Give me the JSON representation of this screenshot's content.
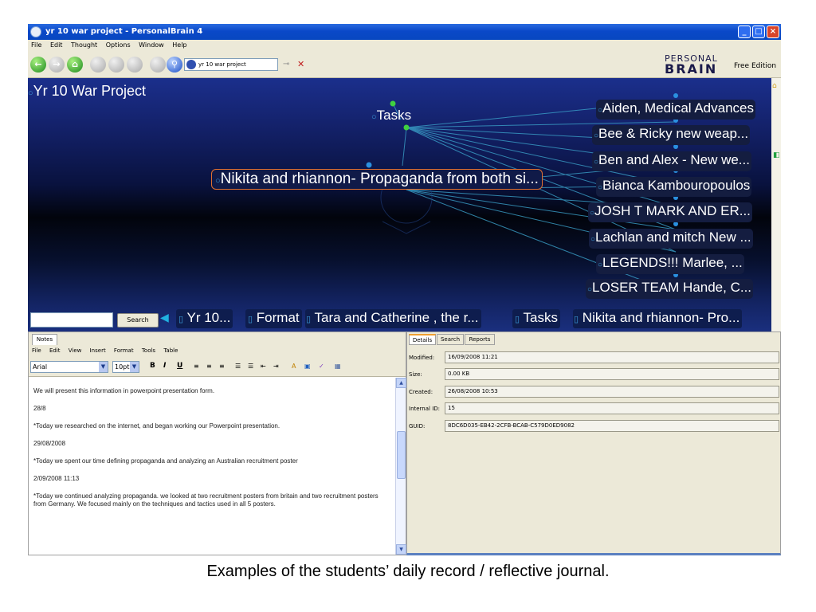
{
  "window": {
    "title": "yr 10 war project - PersonalBrain 4",
    "menu": [
      "File",
      "Edit",
      "Thought",
      "Options",
      "Window",
      "Help"
    ]
  },
  "toolbar": {
    "brain_selector": "yr 10 war project",
    "logo_line1": "PERSONAL",
    "logo_line2": "BRAIN",
    "edition": "Free Edition"
  },
  "plex": {
    "active_thought": "Yr 10 War Project",
    "parent_thought": "Tasks",
    "central_thought": "Nikita and rhiannon- Propaganda from both si...",
    "children": [
      "Aiden, Medical Advances",
      "Bee & Ricky new weap...",
      "Ben and Alex - New we...",
      "Bianca Kambouropoulos",
      "JOSH T MARK AND ER...",
      "Lachlan and mitch New ...",
      "LEGENDS!!!  Marlee, ...",
      "LOSER TEAM Hande, C..."
    ],
    "search_button": "Search",
    "history": [
      "Yr 10...",
      "Format",
      "Tara and Catherine , the r...",
      "Tasks",
      "Nikita and rhiannon- Pro..."
    ]
  },
  "notes": {
    "tab": "Notes",
    "menu": [
      "File",
      "Edit",
      "View",
      "Insert",
      "Format",
      "Tools",
      "Table"
    ],
    "font": "Arial",
    "size": "10pt",
    "bold": "B",
    "italic": "I",
    "underline": "U",
    "paragraphs": [
      "We will present this information in powerpoint presentation form.",
      "28/8",
      "*Today we researched on the internet, and began working our Powerpoint presentation.",
      "29/08/2008",
      "*Today we spent our time defining propaganda and analyzing an Australian recruitment poster",
      "2/09/2008 11:13",
      "*Today we continued analyzing propaganda. we looked at two recruitment posters from britain and two recruitment posters from Germany. We focused mainly on the techniques and tactics used in all 5 posters."
    ]
  },
  "details": {
    "tabs": [
      "Details",
      "Search",
      "Reports"
    ],
    "fields": [
      {
        "label": "Modified:",
        "value": "16/09/2008 11:21"
      },
      {
        "label": "Size:",
        "value": "0.00 KB"
      },
      {
        "label": "Created:",
        "value": "26/08/2008 10:53"
      },
      {
        "label": "Internal ID:",
        "value": "15"
      },
      {
        "label": "GUID:",
        "value": "8DC6D035-EB42-2CFB-BCAB-C579D0ED9082"
      }
    ]
  },
  "caption": "Examples of the students’ daily record / reflective journal.",
  "colors": {
    "plex_background": "#0a1240",
    "link_line": "#3aa0c8",
    "node_dot": "#2a90e0",
    "parent_dot": "#40d040",
    "title_bar": "#0a48c8"
  }
}
